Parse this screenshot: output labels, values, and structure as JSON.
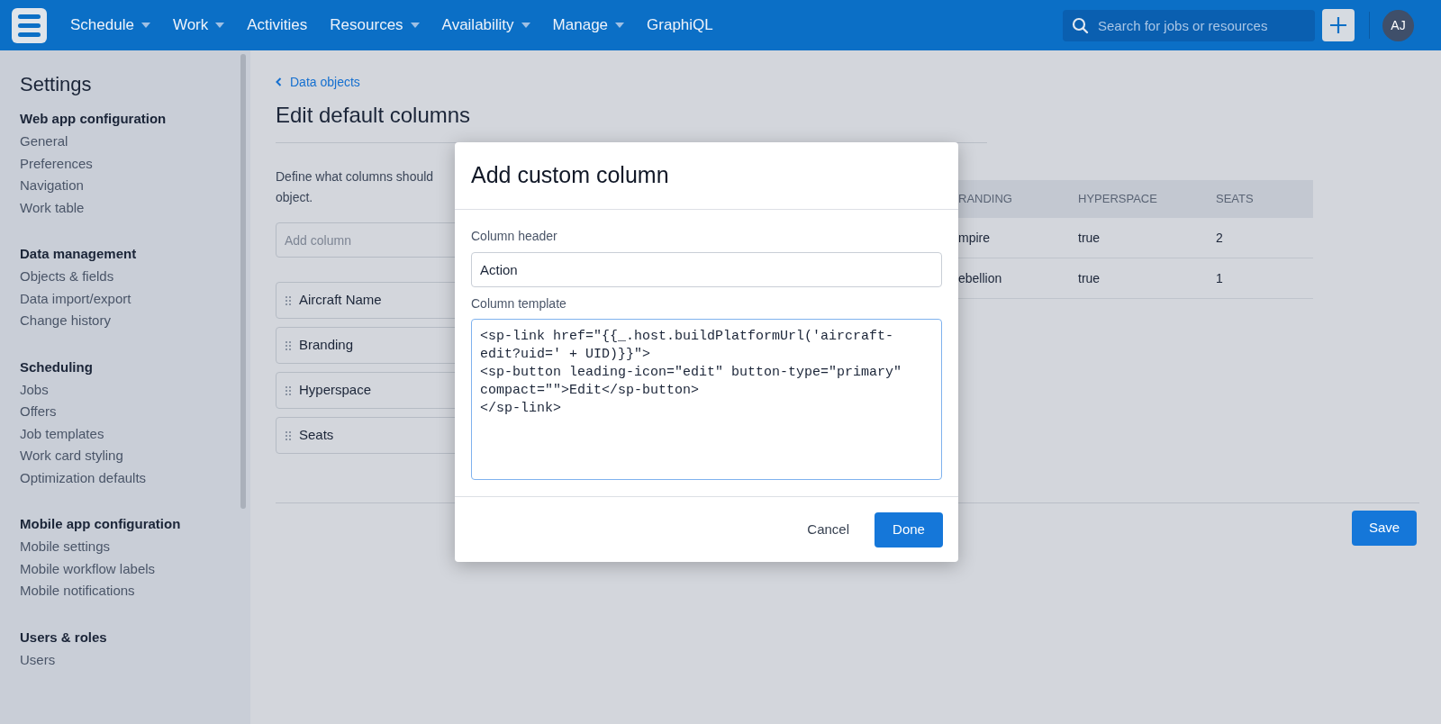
{
  "nav": {
    "items": [
      {
        "label": "Schedule",
        "dropdown": true
      },
      {
        "label": "Work",
        "dropdown": true
      },
      {
        "label": "Activities",
        "dropdown": false
      },
      {
        "label": "Resources",
        "dropdown": true
      },
      {
        "label": "Availability",
        "dropdown": true
      },
      {
        "label": "Manage",
        "dropdown": true
      },
      {
        "label": "GraphiQL",
        "dropdown": false
      }
    ],
    "search": {
      "placeholder": "Search for jobs or resources"
    },
    "avatar": "AJ"
  },
  "sidebar": {
    "title": "Settings",
    "sections": [
      {
        "heading": "Web app configuration",
        "items": [
          "General",
          "Preferences",
          "Navigation",
          "Work table"
        ]
      },
      {
        "heading": "Data management",
        "items": [
          "Objects & fields",
          "Data import/export",
          "Change history"
        ]
      },
      {
        "heading": "Scheduling",
        "items": [
          "Jobs",
          "Offers",
          "Job templates",
          "Work card styling",
          "Optimization defaults"
        ]
      },
      {
        "heading": "Mobile app configuration",
        "items": [
          "Mobile settings",
          "Mobile workflow labels",
          "Mobile notifications"
        ]
      },
      {
        "heading": "Users & roles",
        "items": [
          "Users"
        ]
      }
    ]
  },
  "page": {
    "breadcrumb": "Data objects",
    "title": "Edit default columns",
    "description": [
      "Define what columns should",
      "object."
    ],
    "add_column": {
      "placeholder": "Add column"
    },
    "columns": [
      "Aircraft Name",
      "Branding",
      "Hyperspace",
      "Seats"
    ],
    "table": {
      "columns": [
        "RANDING",
        "HYPERSPACE",
        "SEATS"
      ],
      "rows": [
        [
          "mpire",
          "true",
          "2"
        ],
        [
          "ebellion",
          "true",
          "1"
        ]
      ]
    },
    "save": "Save"
  },
  "dialog": {
    "title": "Add custom column",
    "fields": [
      {
        "kind": "input",
        "label": "Column header",
        "value": "Action"
      },
      {
        "kind": "textarea",
        "label": "Column template",
        "value": "<sp-link href=\"{{_.host.buildPlatformUrl('aircraft-edit?uid=' + UID)}}\">\n<sp-button leading-icon=\"edit\" button-type=\"primary\" compact=\"\">Edit</sp-button>\n</sp-link>"
      }
    ],
    "buttons": [
      {
        "kind": "secondary",
        "label": "Cancel"
      },
      {
        "kind": "primary",
        "label": "Done"
      }
    ]
  }
}
